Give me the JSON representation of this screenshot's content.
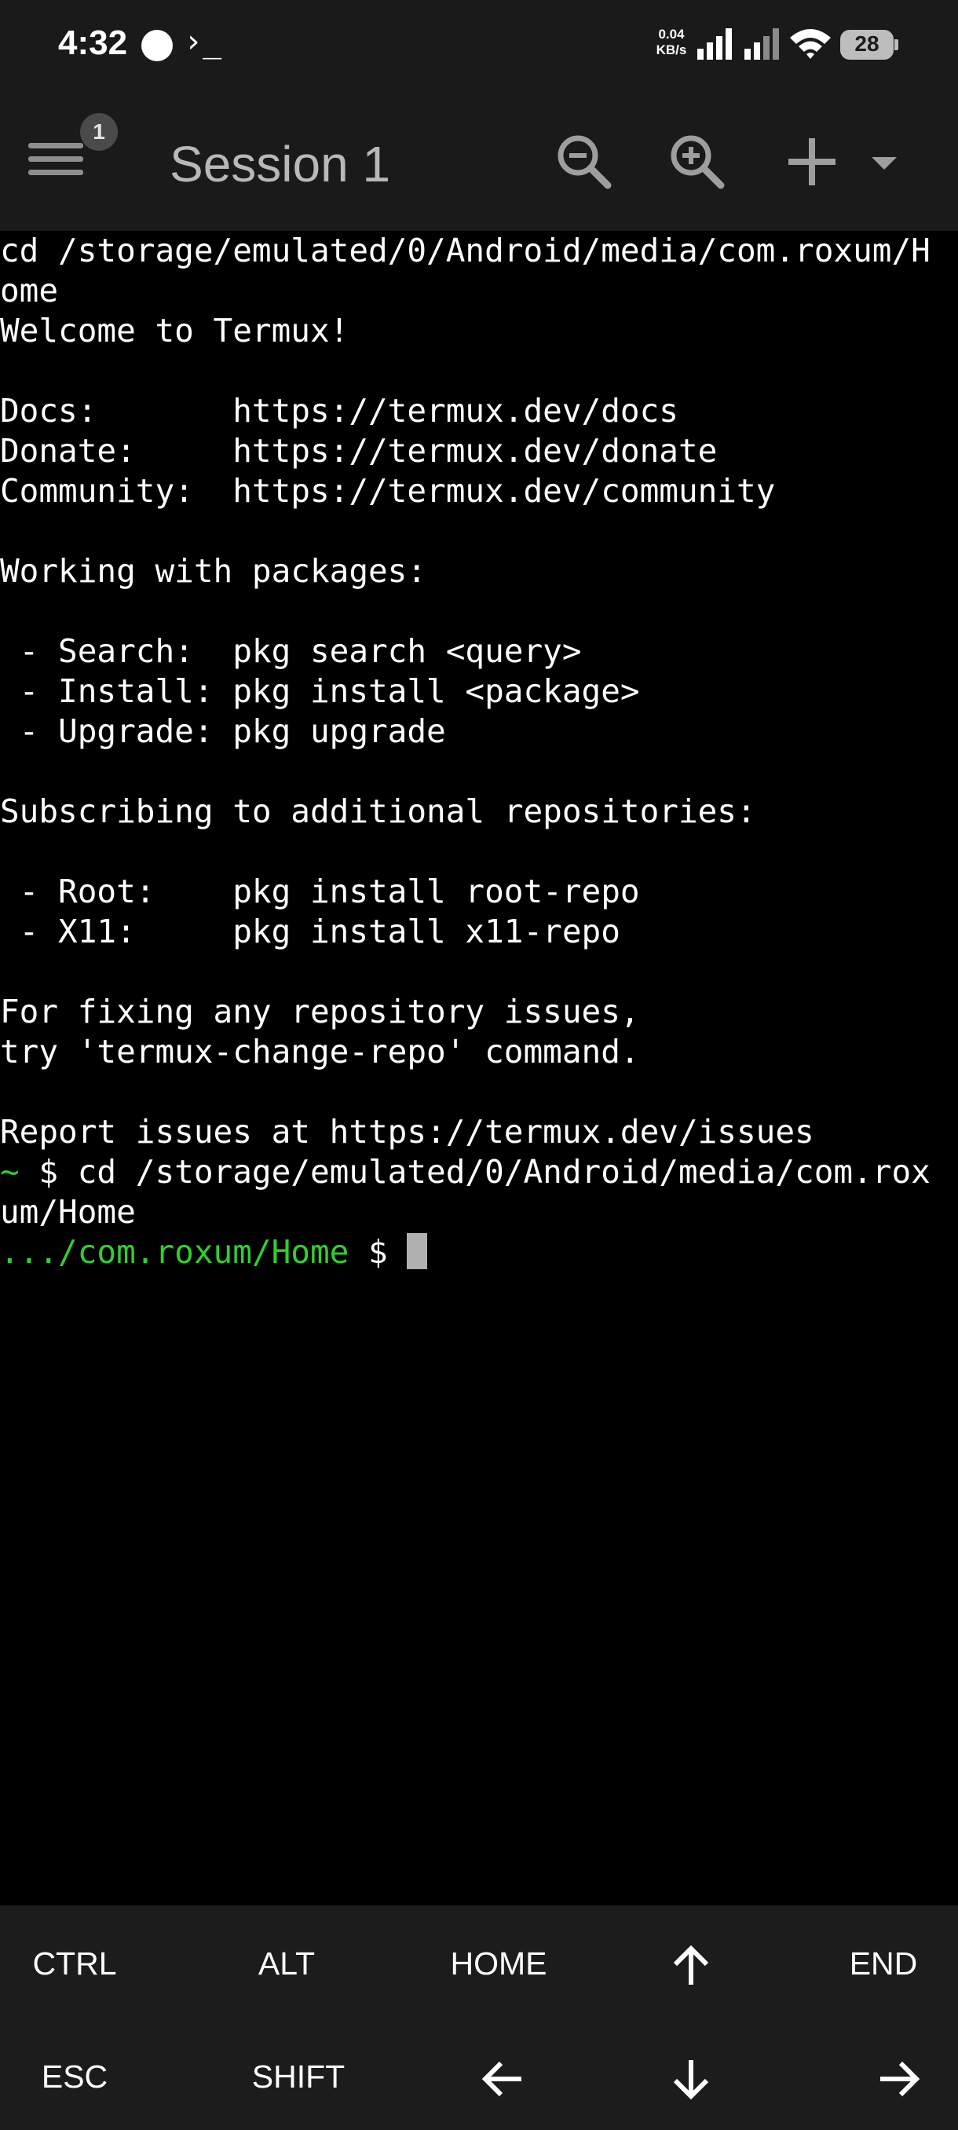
{
  "status_bar": {
    "time": "4:32",
    "prompt_glyph": "›_",
    "net_speed_value": "0.04",
    "net_speed_unit": "KB/s",
    "battery": "28"
  },
  "app_bar": {
    "menu_badge": "1",
    "session_title": "Session 1",
    "icons": [
      "zoom-out-icon",
      "zoom-in-icon",
      "plus-icon",
      "dropdown-icon"
    ]
  },
  "terminal": {
    "lines": [
      "cd /storage/emulated/0/Android/media/com.roxum/H",
      "ome",
      "Welcome to Termux!",
      "",
      "Docs:       https://termux.dev/docs",
      "Donate:     https://termux.dev/donate",
      "Community:  https://termux.dev/community",
      "",
      "Working with packages:",
      "",
      " - Search:  pkg search <query>",
      " - Install: pkg install <package>",
      " - Upgrade: pkg upgrade",
      "",
      "Subscribing to additional repositories:",
      "",
      " - Root:    pkg install root-repo",
      " - X11:     pkg install x11-repo",
      "",
      "For fixing any repository issues,",
      "try 'termux-change-repo' command.",
      "",
      "Report issues at https://termux.dev/issues"
    ],
    "command_prompt": "~",
    "command_text": " $ cd /storage/emulated/0/Android/media/com.rox",
    "command_wrap": "um/Home",
    "current_path": ".../com.roxum/Home",
    "current_prompt": " $ "
  },
  "extra_keys": {
    "row1": [
      "CTRL",
      "ALT",
      "HOME",
      "",
      "END"
    ],
    "row2": [
      "ESC",
      "SHIFT",
      "",
      "",
      ""
    ],
    "arrow_icons": [
      "arrow-up-icon",
      "arrow-left-icon",
      "arrow-down-icon",
      "arrow-right-icon"
    ]
  }
}
